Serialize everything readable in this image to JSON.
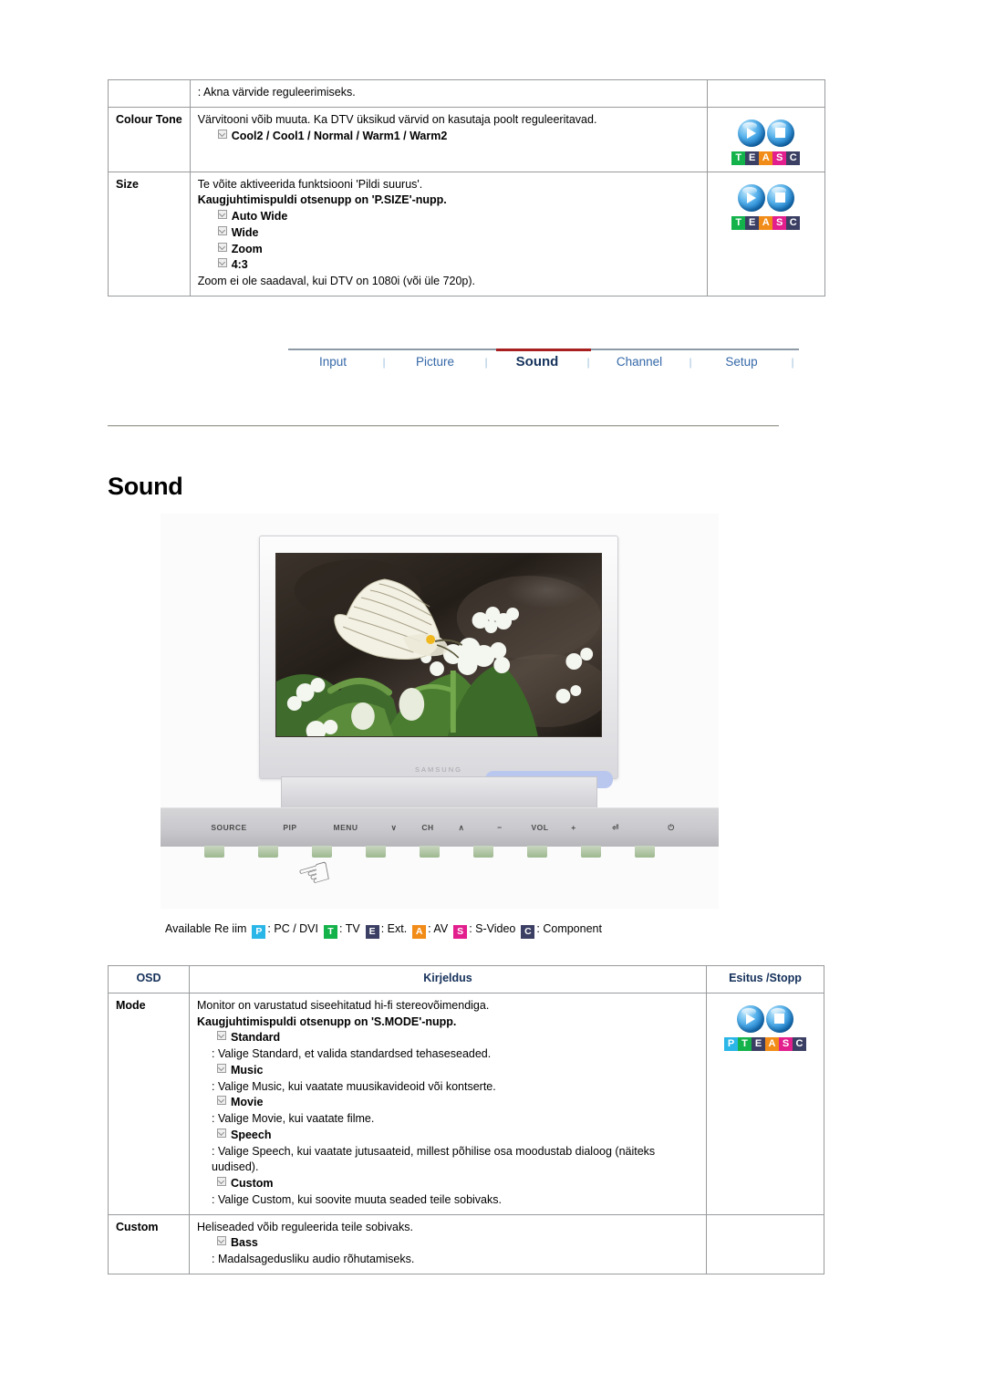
{
  "top_table": {
    "rows": [
      {
        "osd": "",
        "lines": [
          {
            "type": "plain",
            "text": ": Akna värvide reguleerimiseks."
          }
        ],
        "badge": null
      },
      {
        "osd": "Colour Tone",
        "lines": [
          {
            "type": "plain",
            "text": "Värvitooni võib muuta. Ka DTV üksikud värvid on kasutaja poolt reguleeritavad."
          },
          {
            "type": "option",
            "text": "Cool2 / Cool1 / Normal / Warm1 / Warm2"
          }
        ],
        "badge": "TEASC"
      },
      {
        "osd": "Size",
        "lines": [
          {
            "type": "plain",
            "text": "Te võite aktiveerida funktsiooni 'Pildi suurus'."
          },
          {
            "type": "bold",
            "text": "Kaugjuhtimispuldi otsenupp on 'P.SIZE'-nupp."
          },
          {
            "type": "option",
            "text": "Auto Wide"
          },
          {
            "type": "option",
            "text": "Wide"
          },
          {
            "type": "option",
            "text": "Zoom"
          },
          {
            "type": "option",
            "text": "4:3"
          },
          {
            "type": "plain",
            "text": "Zoom ei ole saadaval, kui DTV on 1080i (või üle 720p)."
          }
        ],
        "badge": "TEASC"
      }
    ]
  },
  "tabs": {
    "items": [
      {
        "label": "Input",
        "active": false
      },
      {
        "label": "Picture",
        "active": false
      },
      {
        "label": "Sound",
        "active": true
      },
      {
        "label": "Channel",
        "active": false
      },
      {
        "label": "Setup",
        "active": false
      }
    ],
    "separator": "|",
    "active_color": "#a81f20",
    "link_color": "#3568a8",
    "active_text_color": "#16335c"
  },
  "section": {
    "title": "Sound"
  },
  "illustration": {
    "brand": "SAMSUNG",
    "panel_buttons": [
      "SOURCE",
      "PIP",
      "MENU",
      "∨",
      "CH",
      "∧",
      "−",
      "VOL",
      "+",
      "⏎",
      "⏻"
    ],
    "hand_icon": "pointing-hand"
  },
  "legend": {
    "prefix": "Available Re  iim",
    "entries": [
      {
        "letter": "P",
        "color": "#2bb6e8",
        "label": ": PC / DVI"
      },
      {
        "letter": "T",
        "color": "#13b24a",
        "label": ": TV"
      },
      {
        "letter": "E",
        "color": "#3b3f63",
        "label": ": Ext."
      },
      {
        "letter": "A",
        "color": "#f28c18",
        "label": ": AV"
      },
      {
        "letter": "S",
        "color": "#e21f8d",
        "label": ": S-Video"
      },
      {
        "letter": "C",
        "color": "#3b3f63",
        "label": ": Component"
      }
    ]
  },
  "sound_table": {
    "headers": {
      "osd": "OSD",
      "description": "Kirjeldus",
      "play": "Esitus /Stopp"
    },
    "rows": [
      {
        "osd": "Mode",
        "lines": [
          {
            "type": "plain",
            "text": "Monitor on varustatud siseehitatud hi-fi stereovõimendiga."
          },
          {
            "type": "bold",
            "text": "Kaugjuhtimispuldi otsenupp on 'S.MODE'-nupp."
          },
          {
            "type": "option",
            "text": "Standard"
          },
          {
            "type": "sub",
            "text": ": Valige Standard, et valida standardsed tehaseseaded."
          },
          {
            "type": "option",
            "text": "Music"
          },
          {
            "type": "sub",
            "text": ": Valige Music, kui vaatate muusikavideoid või kontserte."
          },
          {
            "type": "option",
            "text": "Movie"
          },
          {
            "type": "sub",
            "text": ": Valige Movie, kui vaatate filme."
          },
          {
            "type": "option",
            "text": "Speech"
          },
          {
            "type": "sub",
            "text": ": Valige Speech, kui vaatate jutusaateid, millest põhilise osa moodustab dialoog (näiteks uudised)."
          },
          {
            "type": "option",
            "text": "Custom"
          },
          {
            "type": "sub",
            "text": ": Valige Custom, kui soovite muuta seaded teile sobivaks."
          }
        ],
        "badge": "PTEASC"
      },
      {
        "osd": "Custom",
        "lines": [
          {
            "type": "plain",
            "text": "Heliseaded võib reguleerida teile sobivaks."
          },
          {
            "type": "option",
            "text": "Bass"
          },
          {
            "type": "sub",
            "text": ": Madalsagedusliku audio rõhutamiseks."
          }
        ],
        "badge": null
      }
    ]
  },
  "badge_colors": {
    "P": "#2bb6e8",
    "T": "#13b24a",
    "E": "#3b3f63",
    "A": "#f28c18",
    "S": "#e21f8d",
    "C": "#3b3f63"
  }
}
